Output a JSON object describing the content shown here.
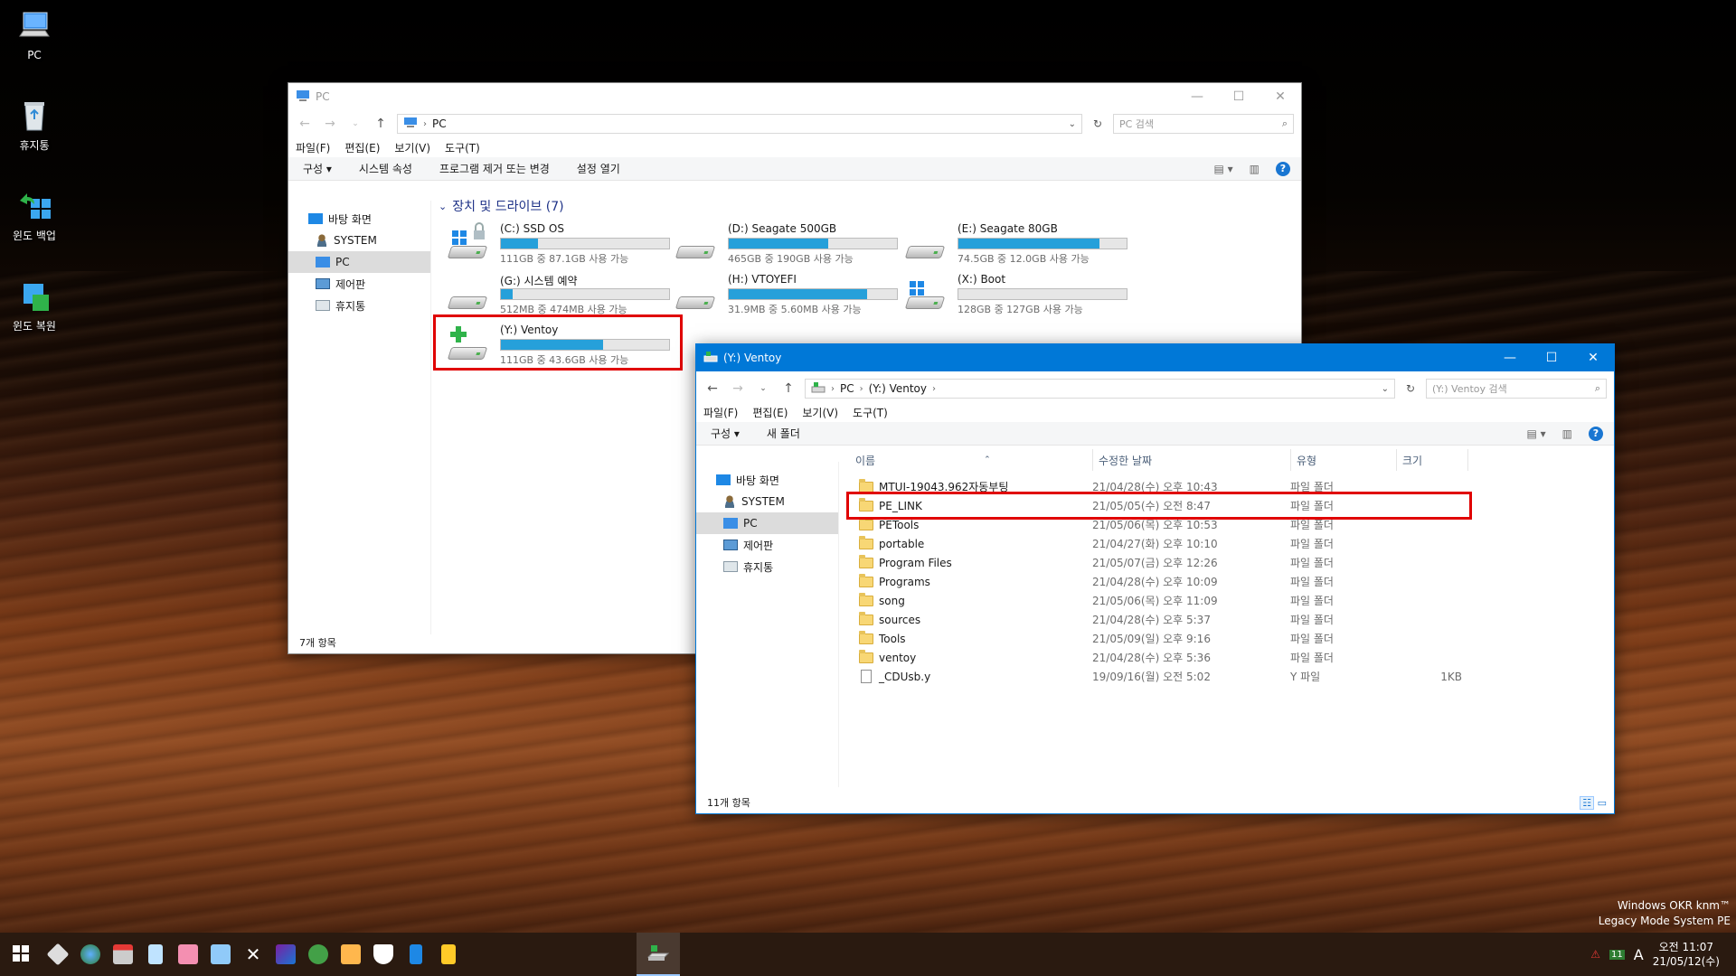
{
  "desktop": {
    "icons": [
      {
        "label": "PC"
      },
      {
        "label": "휴지통"
      },
      {
        "label": "윈도 백업"
      },
      {
        "label": "윈도 복원"
      }
    ],
    "watermark_line1": "Windows OKR  knm™",
    "watermark_line2": "Legacy Mode System PE"
  },
  "win1": {
    "title": "PC",
    "address": "PC",
    "search_placeholder": "PC 검색",
    "menu": [
      "파일(F)",
      "편집(E)",
      "보기(V)",
      "도구(T)"
    ],
    "commands": [
      "구성 ▾",
      "시스템 속성",
      "프로그램 제거 또는 변경",
      "설정 열기"
    ],
    "nav": [
      "바탕 화면",
      "SYSTEM",
      "PC",
      "제어판",
      "휴지통"
    ],
    "group_title": "장치 및 드라이브 (7)",
    "drives": [
      {
        "name": "(C:) SSD OS",
        "free": "111GB 중 87.1GB 사용 가능",
        "used_fraction": 0.22
      },
      {
        "name": "(D:) Seagate 500GB",
        "free": "465GB 중 190GB 사용 가능",
        "used_fraction": 0.59
      },
      {
        "name": "(E:) Seagate 80GB",
        "free": "74.5GB 중 12.0GB 사용 가능",
        "used_fraction": 0.84
      },
      {
        "name": "(G:) 시스템 예약",
        "free": "512MB 중 474MB 사용 가능",
        "used_fraction": 0.07
      },
      {
        "name": "(H:) VTOYEFI",
        "free": "31.9MB 중 5.60MB 사용 가능",
        "used_fraction": 0.82
      },
      {
        "name": "(X:) Boot",
        "free": "128GB 중 127GB 사용 가능",
        "used_fraction": 0.0
      },
      {
        "name": "(Y:) Ventoy",
        "free": "111GB 중 43.6GB 사용 가능",
        "used_fraction": 0.61
      }
    ],
    "status": "7개 항목"
  },
  "win2": {
    "title": "(Y:) Ventoy",
    "address_parts": [
      "PC",
      "(Y:) Ventoy"
    ],
    "search_placeholder": "(Y:) Ventoy 검색",
    "menu": [
      "파일(F)",
      "편집(E)",
      "보기(V)",
      "도구(T)"
    ],
    "commands": [
      "구성 ▾",
      "새 폴더"
    ],
    "nav": [
      "바탕 화면",
      "SYSTEM",
      "PC",
      "제어판",
      "휴지통"
    ],
    "columns": [
      "이름",
      "수정한 날짜",
      "유형",
      "크기"
    ],
    "files": [
      {
        "name": "MTUI-19043.962자동부팅",
        "date": "21/04/28(수) 오후 10:43",
        "type": "파일 폴더",
        "size": "",
        "kind": "folder"
      },
      {
        "name": "PE_LINK",
        "date": "21/05/05(수) 오전 8:47",
        "type": "파일 폴더",
        "size": "",
        "kind": "folder"
      },
      {
        "name": "PETools",
        "date": "21/05/06(목) 오후 10:53",
        "type": "파일 폴더",
        "size": "",
        "kind": "folder"
      },
      {
        "name": "portable",
        "date": "21/04/27(화) 오후 10:10",
        "type": "파일 폴더",
        "size": "",
        "kind": "folder"
      },
      {
        "name": "Program Files",
        "date": "21/05/07(금) 오후 12:26",
        "type": "파일 폴더",
        "size": "",
        "kind": "folder"
      },
      {
        "name": "Programs",
        "date": "21/04/28(수) 오후 10:09",
        "type": "파일 폴더",
        "size": "",
        "kind": "folder"
      },
      {
        "name": "song",
        "date": "21/05/06(목) 오후 11:09",
        "type": "파일 폴더",
        "size": "",
        "kind": "folder"
      },
      {
        "name": "sources",
        "date": "21/04/28(수) 오후 5:37",
        "type": "파일 폴더",
        "size": "",
        "kind": "folder"
      },
      {
        "name": "Tools",
        "date": "21/05/09(일) 오후 9:16",
        "type": "파일 폴더",
        "size": "",
        "kind": "folder"
      },
      {
        "name": "ventoy",
        "date": "21/04/28(수) 오후 5:36",
        "type": "파일 폴더",
        "size": "",
        "kind": "folder"
      },
      {
        "name": "_CDUsb.y",
        "date": "19/09/16(월) 오전 5:02",
        "type": "Y 파일",
        "size": "1KB",
        "kind": "file"
      }
    ],
    "status": "11개 항목"
  },
  "taskbar": {
    "tray_lang": "A",
    "tray_badge": "11",
    "clock_time": "오전 11:07",
    "clock_date": "21/05/12(수)"
  },
  "colors": {
    "accent": "#0078d7",
    "bar_fill": "#26a0da",
    "highlight": "#e00000"
  }
}
